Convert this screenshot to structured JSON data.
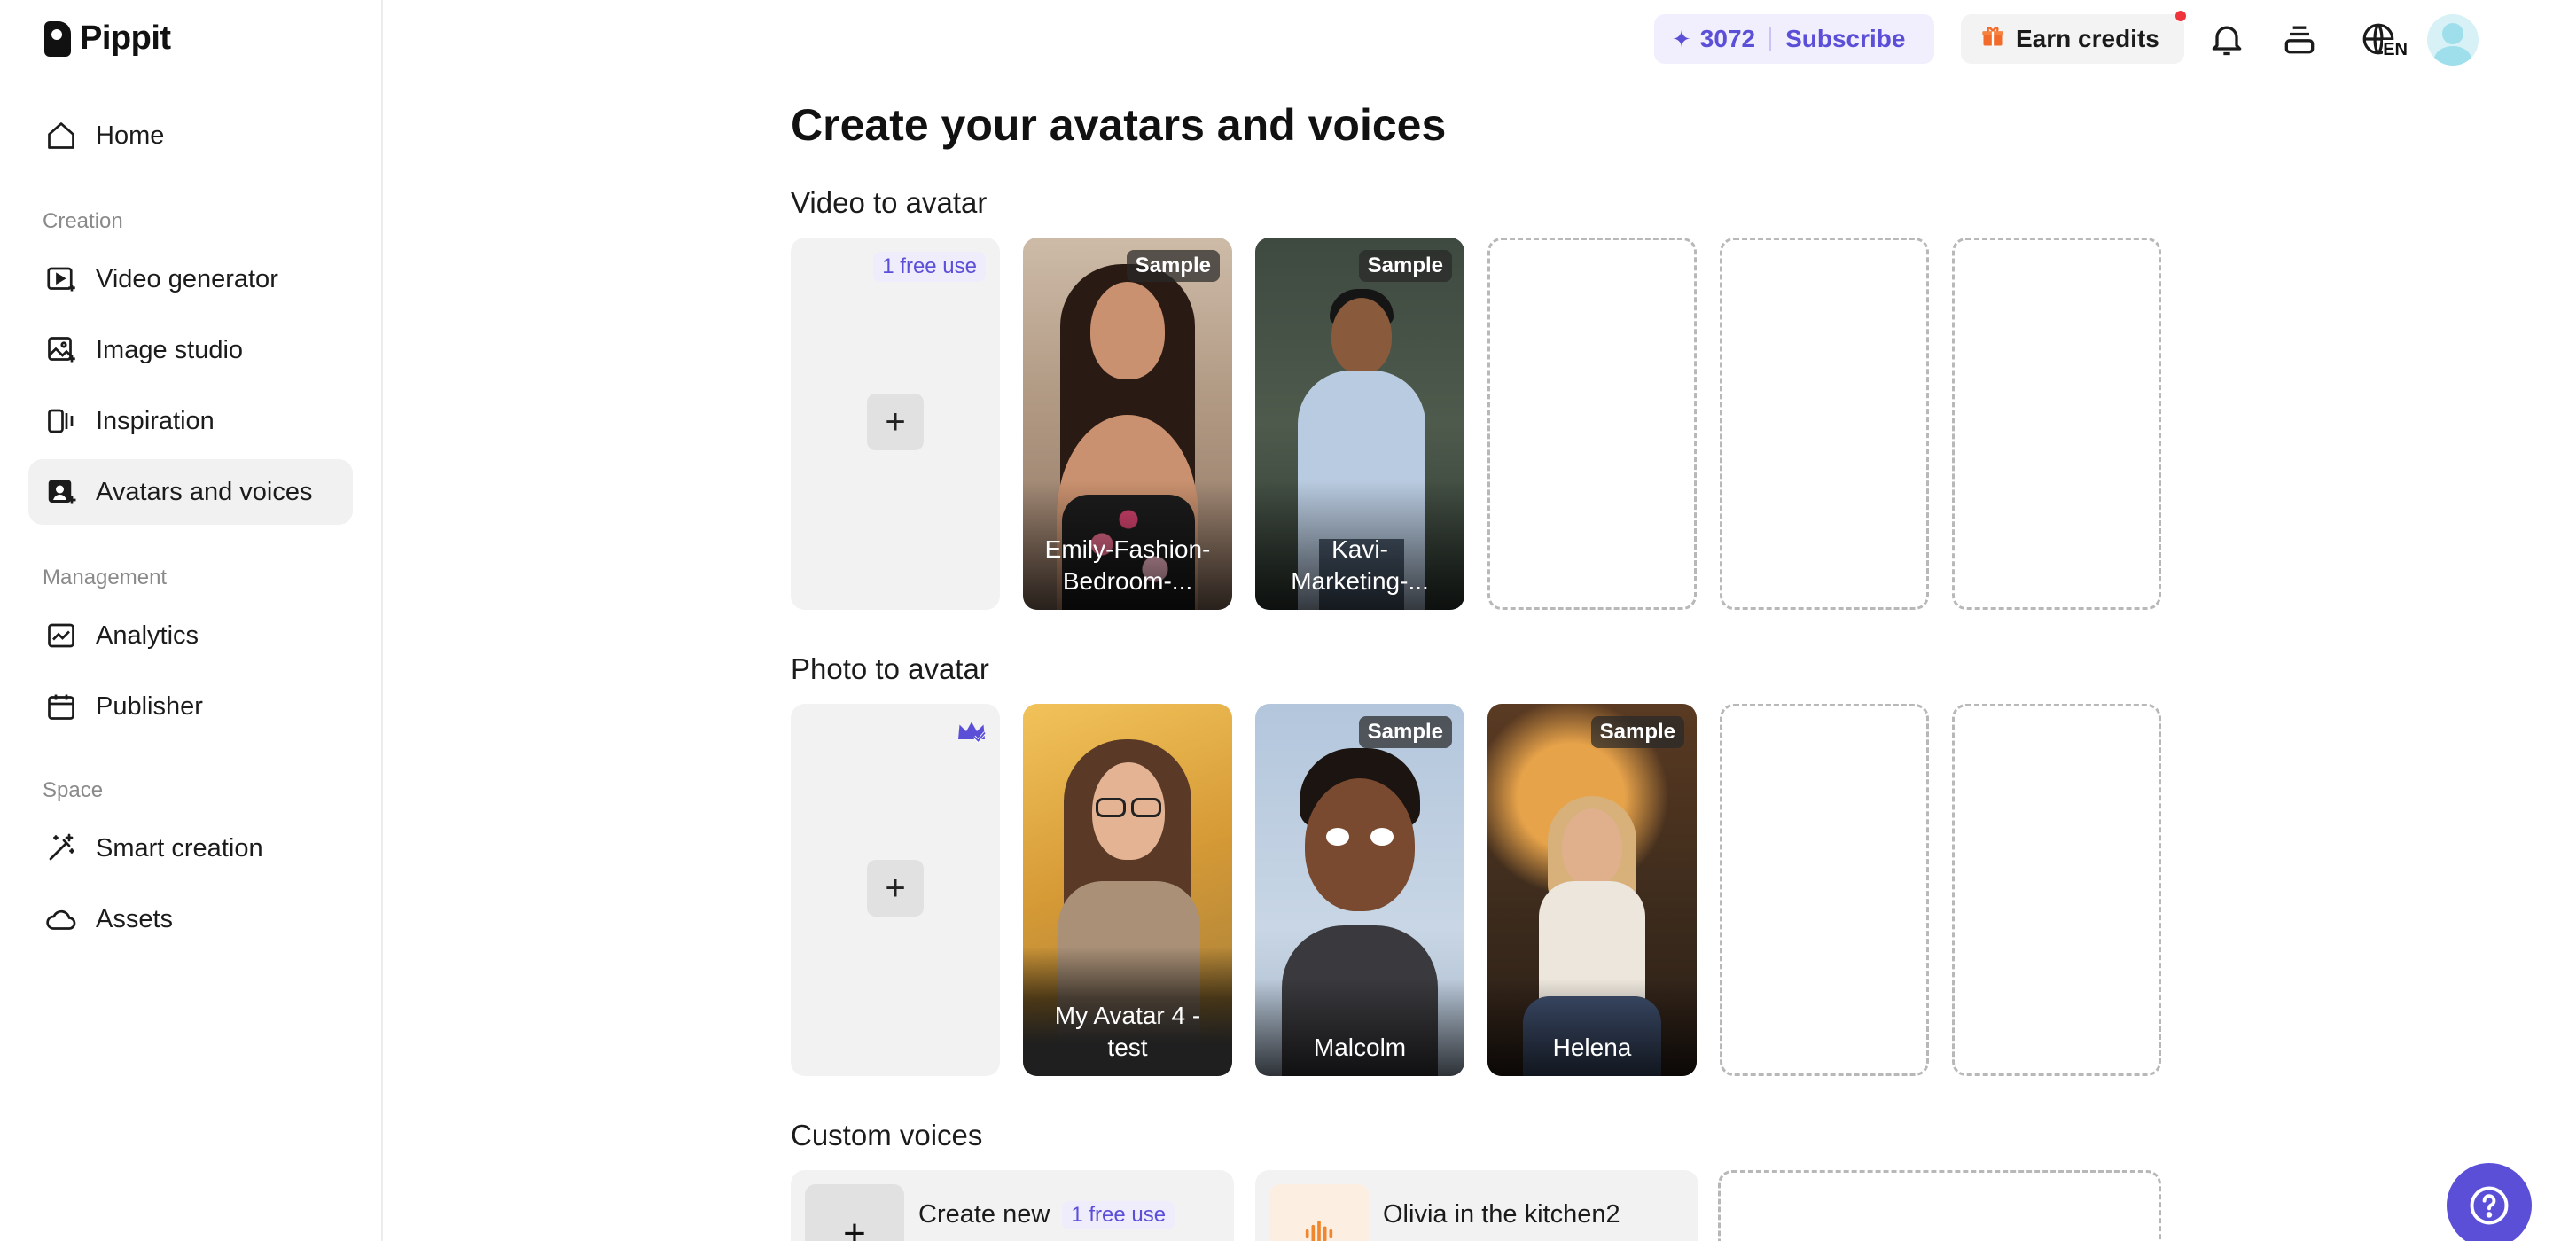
{
  "brand": {
    "name": "Pippit"
  },
  "sidebar": {
    "home": "Home",
    "creation_label": "Creation",
    "creation": [
      "Video generator",
      "Image studio",
      "Inspiration",
      "Avatars and voices"
    ],
    "management_label": "Management",
    "management": [
      "Analytics",
      "Publisher"
    ],
    "space_label": "Space",
    "space": [
      "Smart creation",
      "Assets"
    ]
  },
  "topbar": {
    "credits": "3072",
    "subscribe": "Subscribe",
    "earn_credits": "Earn credits",
    "language": "EN"
  },
  "main": {
    "title": "Create your avatars and voices",
    "video_section": {
      "title": "Video to avatar",
      "free_badge": "1 free use",
      "items": [
        {
          "badge": "Sample",
          "name": "Emily-Fashion-Bedroom-..."
        },
        {
          "badge": "Sample",
          "name": "Kavi-Marketing-..."
        }
      ]
    },
    "photo_section": {
      "title": "Photo to avatar",
      "items": [
        {
          "name": "My Avatar 4 - test"
        },
        {
          "badge": "Sample",
          "name": "Malcolm"
        },
        {
          "badge": "Sample",
          "name": "Helena"
        }
      ]
    },
    "voices_section": {
      "title": "Custom voices",
      "create_new": "Create new",
      "free_badge": "1 free use",
      "items": [
        {
          "name": "Olivia in the kitchen2"
        }
      ]
    }
  },
  "colors": {
    "accent": "#5b4fd8",
    "notification": "#f0343c",
    "active_nav": "#f1f1f1"
  }
}
